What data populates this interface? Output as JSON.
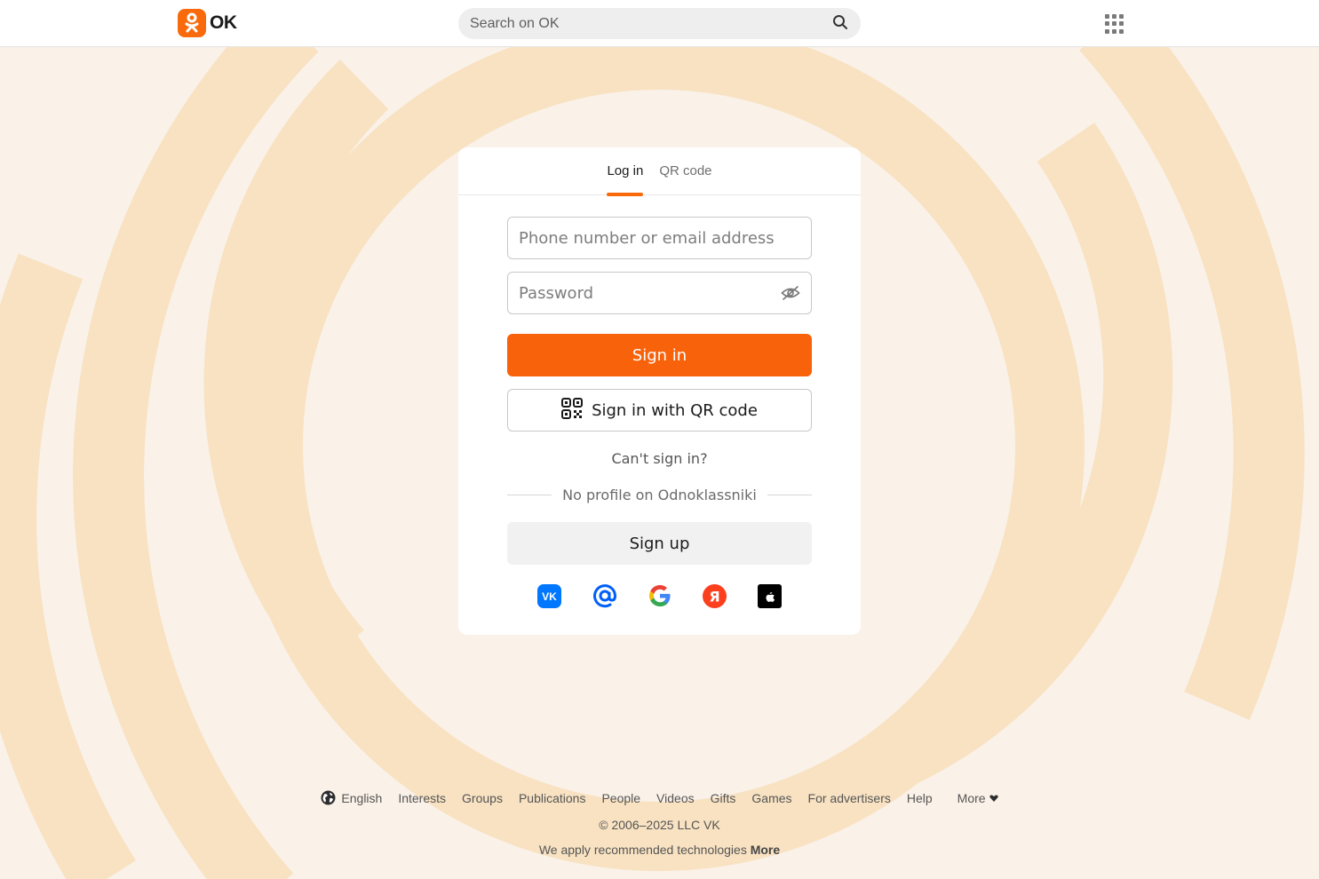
{
  "brand": {
    "name": "OK",
    "accent": "#f96a0d"
  },
  "search": {
    "placeholder": "Search on OK"
  },
  "tabs": [
    {
      "label": "Log in",
      "active": true
    },
    {
      "label": "QR code",
      "active": false
    }
  ],
  "login": {
    "login_placeholder": "Phone number or email address",
    "password_placeholder": "Password",
    "sign_in": "Sign in",
    "sign_in_qr": "Sign in with QR code",
    "cant_sign_in": "Can't sign in?",
    "no_profile": "No profile on Odnoklassniki",
    "sign_up": "Sign up"
  },
  "socials": [
    "vk-icon",
    "mail-icon",
    "google-icon",
    "yandex-icon",
    "apple-icon"
  ],
  "footer": {
    "language": "English",
    "links": [
      "Interests",
      "Groups",
      "Publications",
      "People",
      "Videos",
      "Gifts",
      "Games",
      "For advertisers",
      "Help"
    ],
    "more": "More",
    "copyright": "© 2006–2025 LLC VK",
    "tech_text": "We apply recommended technologies",
    "tech_more": "More"
  }
}
